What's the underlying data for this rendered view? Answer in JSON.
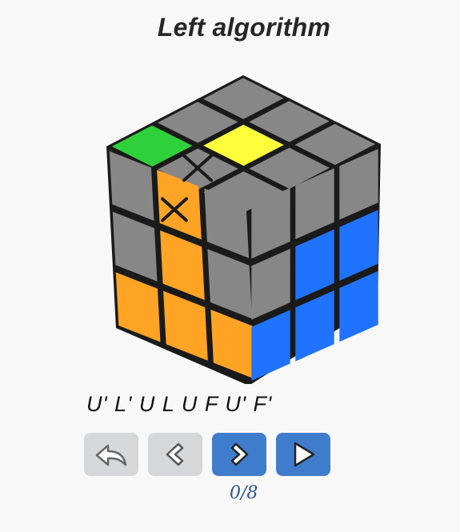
{
  "title": "Left algorithm",
  "algorithm": "U' L' U L U F U' F'",
  "progress": {
    "current": 0,
    "total": 8,
    "label": "0/8"
  },
  "colors": {
    "background": "#f8f8f8",
    "cube_gray": "#878787",
    "cube_yellow": "#ffff3b",
    "cube_green": "#2fd13a",
    "cube_orange": "#ffa425",
    "cube_blue": "#1f73ff",
    "button_gray": "#d6d7d9",
    "button_blue": "#3f7ccc",
    "counter_text": "#2f5590"
  },
  "cube": {
    "top_face": [
      "gray",
      "gray",
      "gray",
      "gray",
      "yellow",
      "gray",
      "green",
      "gray",
      "gray"
    ],
    "left_face": [
      "gray",
      "orange",
      "gray",
      "gray",
      "orange",
      "gray",
      "orange",
      "orange",
      "orange"
    ],
    "right_face": [
      "gray",
      "gray",
      "gray",
      "gray",
      "blue",
      "blue",
      "blue",
      "blue",
      "blue"
    ],
    "marked_stickers": [
      "top-green",
      "left-orange-top"
    ]
  },
  "controls": [
    {
      "name": "reset-button",
      "icon": "undo-arrow-icon",
      "style": "gray"
    },
    {
      "name": "step-back-button",
      "icon": "chevron-left-icon",
      "style": "gray"
    },
    {
      "name": "step-forward-button",
      "icon": "chevron-right-icon",
      "style": "blue"
    },
    {
      "name": "play-button",
      "icon": "play-icon",
      "style": "blue"
    }
  ]
}
